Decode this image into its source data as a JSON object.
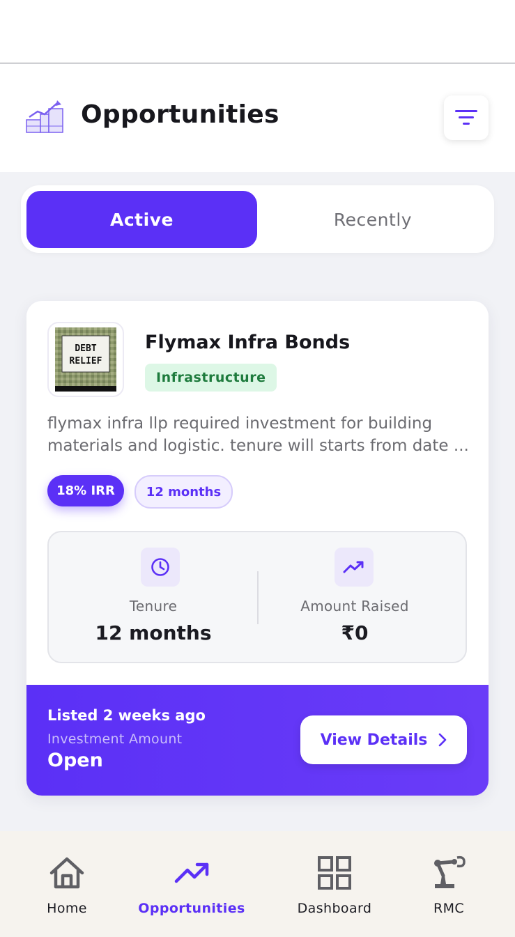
{
  "header": {
    "title": "Opportunities",
    "logo_icon": "growth-chart-logo-icon",
    "filter_icon": "filter-icon"
  },
  "tabs": [
    {
      "label": "Active",
      "selected": true
    },
    {
      "label": "Recently",
      "selected": false
    }
  ],
  "card": {
    "thumbnail_text": [
      "DEBT",
      "RELIEF"
    ],
    "title": "Flymax Infra Bonds",
    "category": "Infrastructure",
    "description": "flymax infra llp required investment for building materials and logistic. tenure will starts from date ...",
    "irr_pill": "18% IRR",
    "tenure_pill": "12 months",
    "stats": {
      "tenure_label": "Tenure",
      "tenure_value": "12 months",
      "amount_label": "Amount Raised",
      "amount_value": "₹0"
    },
    "footer": {
      "listed": "Listed 2 weeks ago",
      "investment_label": "Investment Amount",
      "investment_value": "Open",
      "view_button": "View Details"
    }
  },
  "colors": {
    "accent": "#5b30f6",
    "badge_bg": "#ddf7e6",
    "badge_text": "#1e7b3d"
  },
  "nav": [
    {
      "label": "Home",
      "icon": "home-icon",
      "active": false
    },
    {
      "label": "Opportunities",
      "icon": "trending-up-icon",
      "active": true
    },
    {
      "label": "Dashboard",
      "icon": "grid-icon",
      "active": false
    },
    {
      "label": "RMC",
      "icon": "robot-arm-icon",
      "active": false
    }
  ]
}
